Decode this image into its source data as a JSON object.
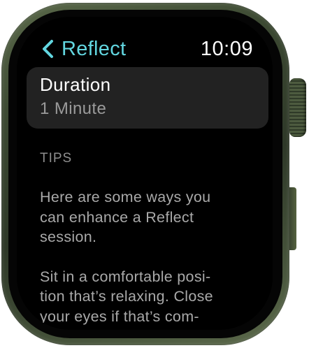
{
  "header": {
    "back_label": "Reflect",
    "time": "10:09",
    "back_icon": "chevron-left-icon",
    "accent_color": "#62d6e0"
  },
  "duration": {
    "title": "Duration",
    "value": "1 Minute"
  },
  "tips": {
    "heading": "TIPS",
    "paragraphs": [
      "Here are some ways you\ncan enhance a Reflect\nsession.",
      "Sit in a comfortable posi-\ntion that’s relaxing. Close\nyour eyes if that’s com-"
    ]
  },
  "device": {
    "case_color": "#3d4a33"
  }
}
